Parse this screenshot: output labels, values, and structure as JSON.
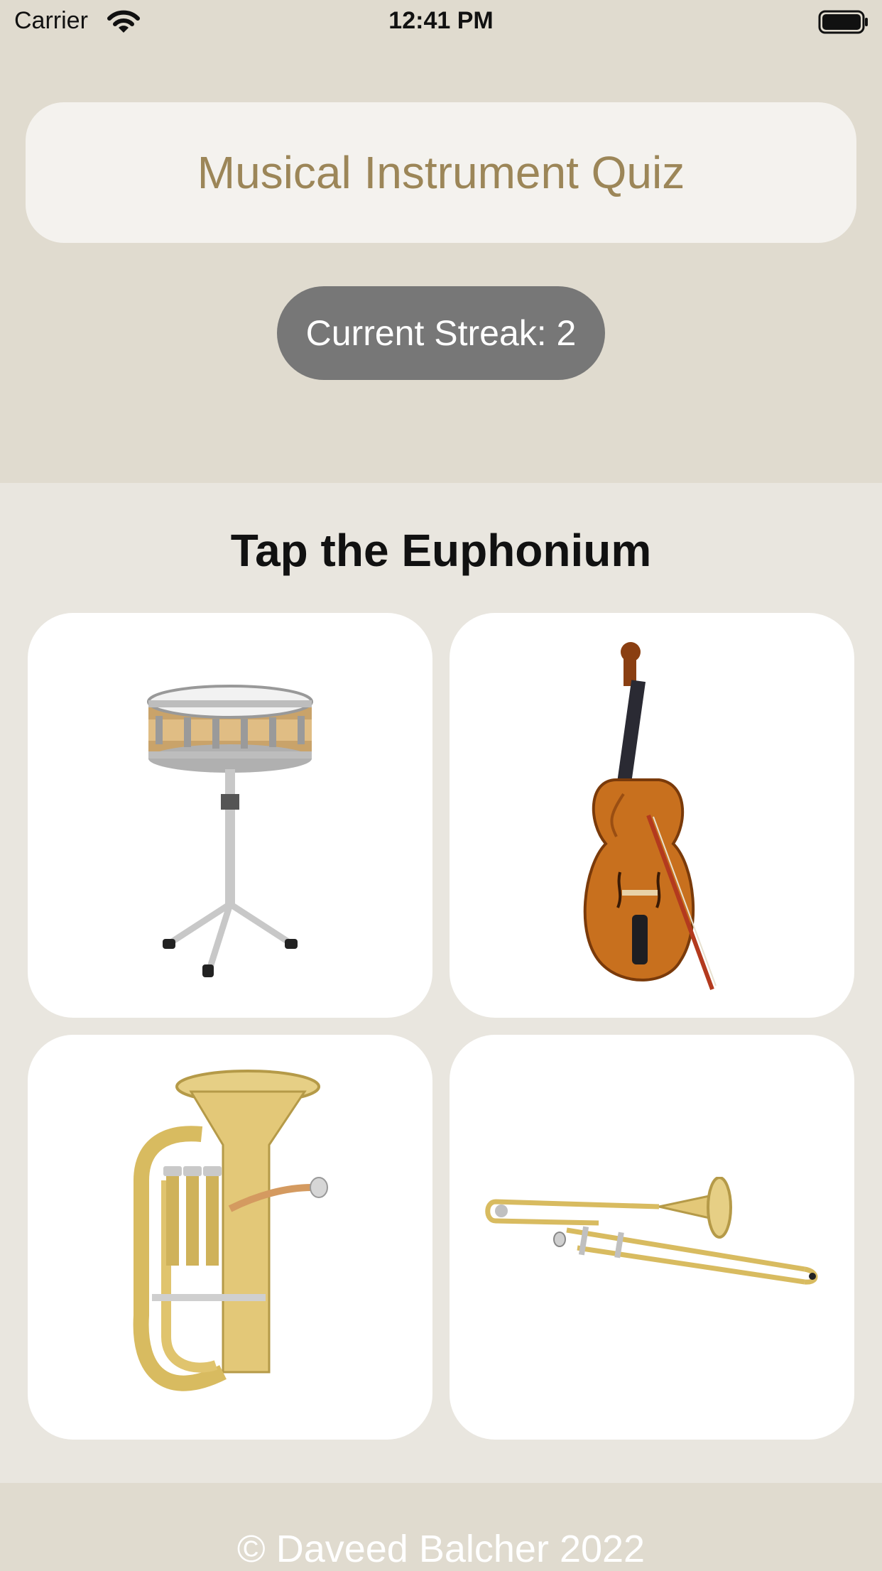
{
  "status_bar": {
    "carrier": "Carrier",
    "time": "12:41 PM",
    "wifi_icon": "wifi-icon",
    "battery_icon": "battery-icon"
  },
  "header": {
    "title": "Musical Instrument Quiz",
    "streak": "Current Streak: 2"
  },
  "quiz": {
    "prompt": "Tap the Euphonium",
    "choices": [
      {
        "icon": "snare-drum-icon"
      },
      {
        "icon": "cello-icon"
      },
      {
        "icon": "euphonium-icon"
      },
      {
        "icon": "trombone-icon"
      }
    ]
  },
  "footer": {
    "copyright": "© Daveed Balcher 2022"
  },
  "colors": {
    "background": "#e0dbcf",
    "panel": "#e9e6df",
    "title_card": "#f4f2ee",
    "title_text": "#9c8658",
    "streak_pill": "#777777",
    "card": "#ffffff"
  }
}
